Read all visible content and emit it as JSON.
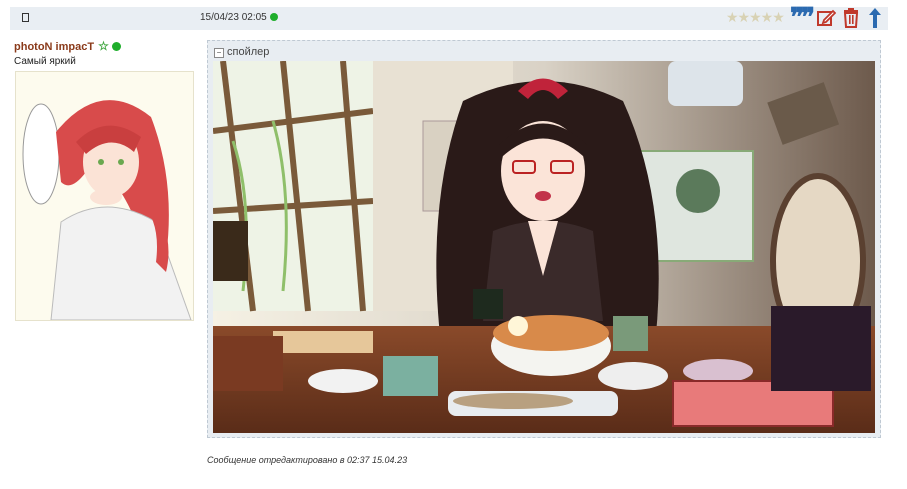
{
  "post": {
    "datetime": "15/04/23 02:05",
    "rating_stars": "★★★★★",
    "author": "photoN impacT",
    "user_title": "Самый яркий",
    "spoiler_label": "спойлер",
    "edited_note": "Сообщение отредактировано в 02:37 15.04.23"
  },
  "icons": {
    "doc": "document-icon",
    "quote": "quote-icon",
    "edit": "edit-icon",
    "delete": "trash-icon",
    "up": "arrow-up-icon",
    "star": "star-icon"
  },
  "colors": {
    "author": "#8a3a1a",
    "online": "#1fae2c",
    "accent_blue": "#2b6ab0",
    "delete_red": "#c0392b",
    "bar_bg": "#e9eef3"
  }
}
